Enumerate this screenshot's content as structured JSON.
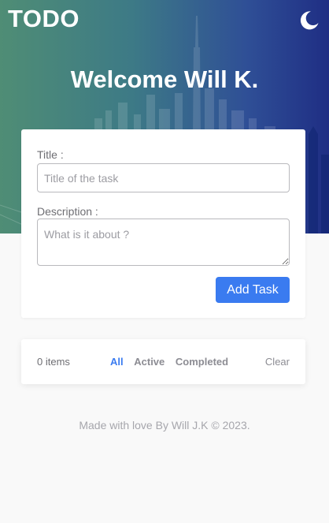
{
  "header": {
    "brand": "TODO",
    "theme_toggle_icon": "moon-icon",
    "welcome": "Welcome Will K."
  },
  "form": {
    "title_label": "Title :",
    "title_placeholder": "Title of the task",
    "title_value": "",
    "description_label": "Description :",
    "description_placeholder": "What is it about ?",
    "description_value": "",
    "submit_label": "Add Task"
  },
  "filters": {
    "items_count": "0 items",
    "tabs": [
      {
        "label": "All",
        "active": true
      },
      {
        "label": "Active",
        "active": false
      },
      {
        "label": "Completed",
        "active": false
      }
    ],
    "clear_label": "Clear"
  },
  "footer": {
    "text": "Made with love By Will J.K © 2023."
  },
  "colors": {
    "accent": "#3a7bf0",
    "hero_gradient_start": "#4f8d75",
    "hero_gradient_end": "#1f2e84",
    "page_background": "#f9f9f9"
  }
}
